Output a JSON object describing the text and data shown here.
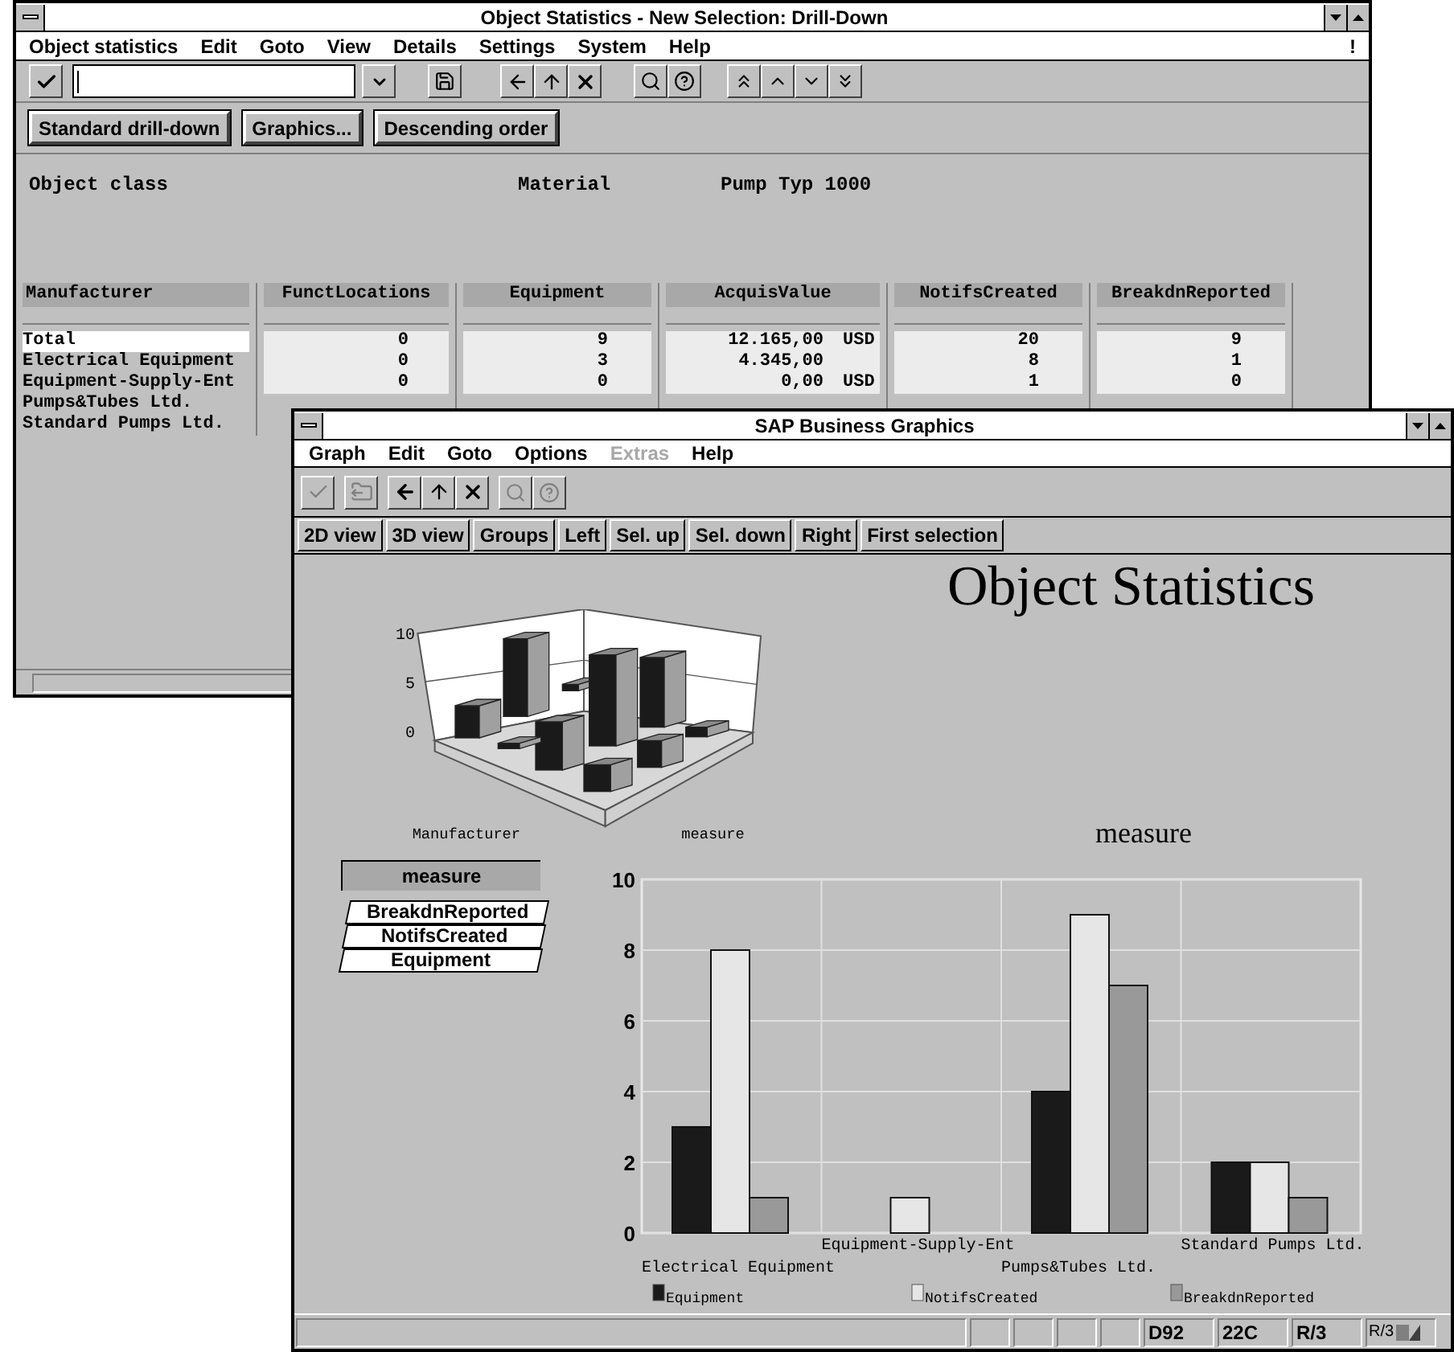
{
  "main_window": {
    "title": "Object Statistics - New Selection: Drill-Down",
    "menu": [
      "Object statistics",
      "Edit",
      "Goto",
      "View",
      "Details",
      "Settings",
      "System",
      "Help"
    ],
    "menu_flag": "!",
    "buttons": [
      "Standard drill-down",
      "Graphics...",
      "Descending order"
    ],
    "header_fields": [
      "Object class",
      "Material",
      "Pump Typ 1000"
    ],
    "table": {
      "columns": [
        "Manufacturer",
        "FunctLocations",
        "Equipment",
        "AcquisValue",
        "NotifsCreated",
        "BreakdnReported"
      ],
      "rows": [
        {
          "manufacturer": "Total",
          "values": [
            "0",
            "9",
            "12.165,00",
            "20",
            "9"
          ],
          "currency": "USD"
        },
        {
          "manufacturer": "Electrical Equipment",
          "values": [
            "0",
            "3",
            "4.345,00",
            "8",
            "1"
          ]
        },
        {
          "manufacturer": "Equipment-Supply-Ent",
          "values": [
            "0",
            "0",
            "0,00",
            "1",
            "0"
          ],
          "currency": "USD"
        },
        {
          "manufacturer": "Pumps&Tubes Ltd."
        },
        {
          "manufacturer": "Standard Pumps Ltd."
        }
      ]
    }
  },
  "graphics_window": {
    "title": "SAP Business Graphics",
    "menu": [
      {
        "label": "Graph",
        "disabled": false
      },
      {
        "label": "Edit",
        "disabled": false
      },
      {
        "label": "Goto",
        "disabled": false
      },
      {
        "label": "Options",
        "disabled": false
      },
      {
        "label": "Extras",
        "disabled": true
      },
      {
        "label": "Help",
        "disabled": false
      }
    ],
    "buttons": [
      "2D view",
      "3D view",
      "Groups",
      "Left",
      "Sel. up",
      "Sel. down",
      "Right",
      "First selection"
    ],
    "heading": "Object Statistics",
    "chart_3d": {
      "tick_labels": [
        "10",
        "5",
        "0"
      ],
      "x_axis_label": "Manufacturer",
      "y_axis_label": "measure"
    },
    "legend": {
      "title": "measure",
      "items": [
        "BreakdnReported",
        "NotifsCreated",
        "Equipment"
      ]
    },
    "chart": {
      "chart_data": {
        "type": "bar",
        "title": "measure",
        "categories": [
          "Electrical Equipment",
          "Equipment-Supply-Ent",
          "Pumps&Tubes Ltd.",
          "Standard Pumps Ltd."
        ],
        "series": [
          {
            "name": "Equipment",
            "color": "#1a1a1a",
            "values": [
              3,
              0,
              4,
              2
            ]
          },
          {
            "name": "NotifsCreated",
            "color": "#e6e6e6",
            "values": [
              8,
              1,
              9,
              2
            ]
          },
          {
            "name": "BreakdnReported",
            "color": "#999999",
            "values": [
              1,
              0,
              7,
              1
            ]
          }
        ],
        "ylim": [
          0,
          10
        ],
        "yticks": [
          {
            "value": 0,
            "label": "0"
          },
          {
            "value": 2,
            "label": "2"
          },
          {
            "value": 4,
            "label": "4"
          },
          {
            "value": 6,
            "label": "6"
          },
          {
            "value": 8,
            "label": "8"
          },
          {
            "value": 10,
            "label": "10"
          }
        ],
        "grid": true,
        "legend": true
      }
    },
    "status_bar": {
      "fields": [
        "D92",
        "22C",
        "R/3"
      ],
      "badge": "R/3"
    }
  }
}
